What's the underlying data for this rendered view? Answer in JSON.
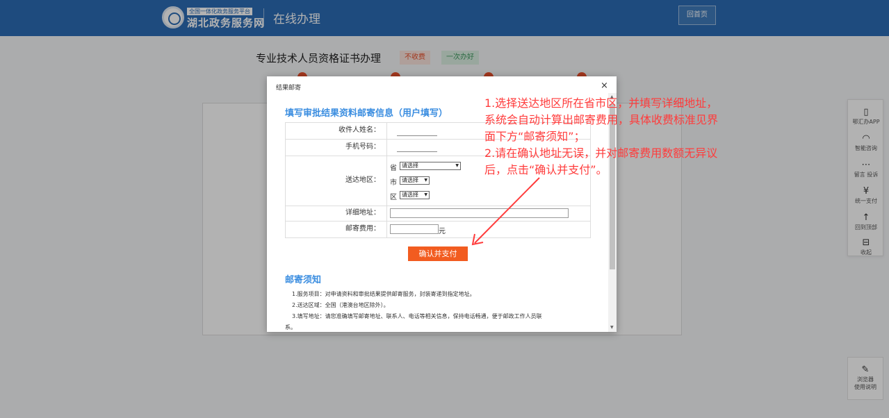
{
  "header": {
    "logo_small": "全国一体化政务服务平台",
    "logo_big": "湖北政务服务网",
    "title": "在线办理",
    "home_button": "回首页"
  },
  "page": {
    "title": "专业技术人员资格证书办理",
    "tag_fee": "不收费",
    "tag_once": "一次办好"
  },
  "sidebar": {
    "items": [
      {
        "icon": "phone-icon",
        "glyph": "▯",
        "label": "鄂汇办APP"
      },
      {
        "icon": "headset-icon",
        "glyph": "◠",
        "label": "智能咨询"
      },
      {
        "icon": "message-icon",
        "glyph": "⋯",
        "label": "留言 投诉"
      },
      {
        "icon": "yen-icon",
        "glyph": "¥",
        "label": "统一支付"
      },
      {
        "icon": "to-top-icon",
        "glyph": "↑",
        "label": "回到顶部"
      },
      {
        "icon": "collapse-icon",
        "glyph": "⊟",
        "label": "收起"
      }
    ],
    "browser_icon_glyph": "✎",
    "browser_label_1": "浏览器",
    "browser_label_2": "使用说明"
  },
  "dialog": {
    "title": "结果邮寄",
    "close": "×",
    "section_title": "填写审批结果资料邮寄信息（用户填写）",
    "form": {
      "recipient_label": "收件人姓名：",
      "phone_label": "手机号码：",
      "region_label": "送达地区：",
      "province_prefix": "省",
      "city_prefix": "市",
      "district_prefix": "区",
      "select_placeholder": "请选择",
      "address_label": "详细地址：",
      "fee_label": "邮寄费用：",
      "fee_unit": "元"
    },
    "confirm_button": "确认并支付",
    "notice_title": "邮寄须知",
    "notice_lines": [
      "1.服务项目：对申请资料和审批结果提供邮寄服务，封装寄递到指定地址。",
      "2.送达区域：全国（港澳台地区除外）。",
      "3.填写地址：请您准确填写邮寄地址、联系人、电话等相关信息，保持电话畅通，便于邮政工作人员联",
      "系。"
    ]
  },
  "annotation": {
    "lines": [
      "1.选择送达地区所在省市区，并填写详细地址，",
      "系统会自动计算出邮寄费用，具体收费标准见界",
      "面下方“邮寄须知”；",
      "2.请在确认地址无误，并对邮寄费用数额无异议",
      "后，点击“确认并支付”。"
    ],
    "color": "#ff3b3b"
  }
}
